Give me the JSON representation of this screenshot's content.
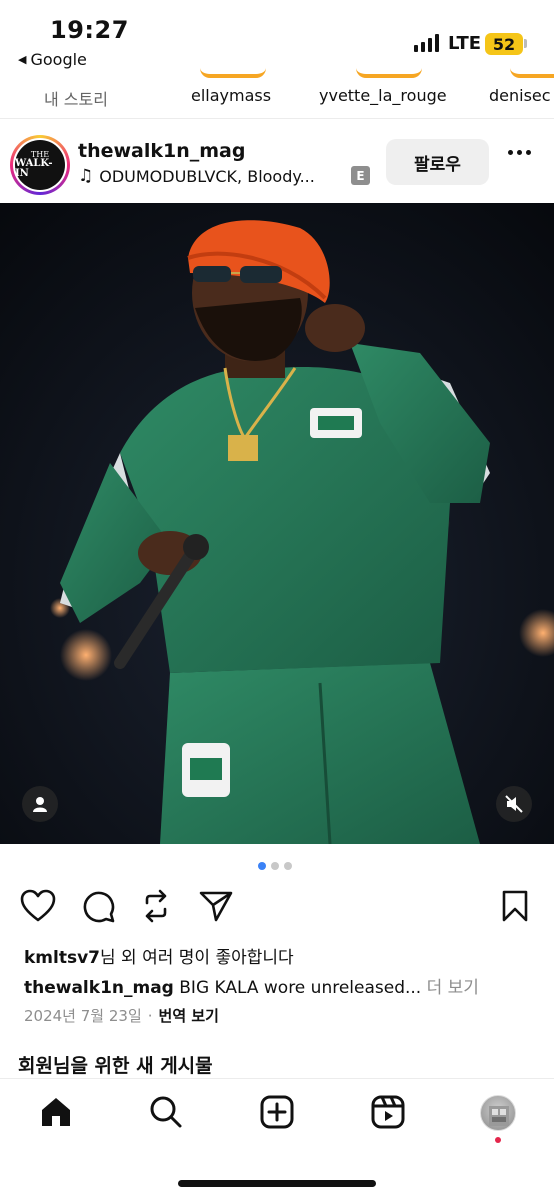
{
  "status_bar": {
    "time": "19:27",
    "back_app": "Google",
    "network": "LTE",
    "battery": "52"
  },
  "stories": [
    {
      "name": "내 스토리",
      "is_me": true
    },
    {
      "name": "ellaymass",
      "is_me": false
    },
    {
      "name": "yvette_la_rouge",
      "is_me": false
    },
    {
      "name": "denisec",
      "is_me": false
    }
  ],
  "post": {
    "username": "thewalk1n_mag",
    "avatar_text_top": "THE",
    "avatar_text_bottom": "WALK-IN",
    "music": "ODUMODUBLVCK, Bloody...",
    "explicit_badge": "E",
    "follow_label": "팔로우",
    "likes_user": "kmltsv7",
    "likes_suffix": "님 외 여러 명이 좋아합니다",
    "caption_user": "thewalk1n_mag",
    "caption_text": " BIG KALA wore unreleased...",
    "caption_more": "더 보기",
    "date": "2024년 7월 23일",
    "meta_separator": "·",
    "translate": "번역 보기",
    "carousel_count": 3,
    "carousel_active": 0
  },
  "section_title": "회원님을 위한 새 게시물",
  "icons": {
    "like": "heart-icon",
    "comment": "comment-icon",
    "repost": "repost-icon",
    "share": "send-icon",
    "save": "bookmark-icon",
    "home": "home-icon",
    "search": "search-icon",
    "create": "plus-square-icon",
    "reels": "reels-icon",
    "user_tag": "person-icon",
    "mute": "speaker-muted-icon"
  },
  "colors": {
    "story_ring": "#f6a623",
    "accent_dot": "#3b82f6",
    "notification": "#e4264b",
    "battery": "#f5c518"
  }
}
